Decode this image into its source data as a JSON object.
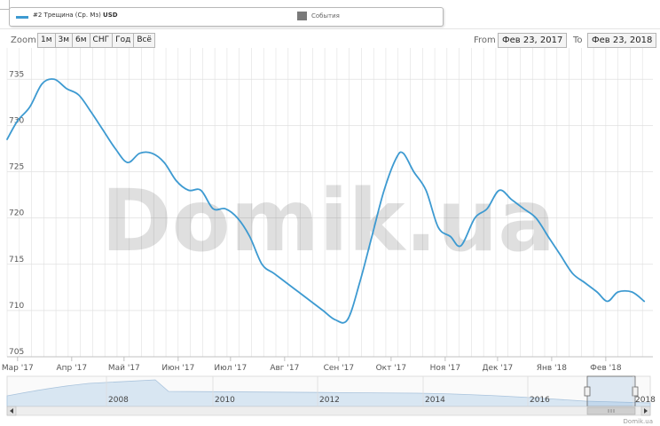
{
  "legend": {
    "series_label": "#2 Трещина (Ср. Мз)",
    "unit_label": "USD",
    "events_label": "События"
  },
  "toolbar": {
    "zoom_label": "Zoom",
    "buttons": [
      "1м",
      "3м",
      "6м",
      "СНГ",
      "Год",
      "Всё"
    ],
    "from_label": "From",
    "from_value": "Фев 23, 2017",
    "to_label": "To",
    "to_value": "Фев 23, 2018"
  },
  "watermark": "Domik.ua",
  "credit": "Domik.ua",
  "colors": {
    "line": "#3d9ad1",
    "navigator_fill": "#d8e6f2",
    "grid": "#e0e0e0"
  },
  "chart_data": {
    "type": "line",
    "ylim": [
      705,
      738
    ],
    "y_ticks": [
      705,
      710,
      715,
      720,
      725,
      730,
      735
    ],
    "x_range": [
      "2017-02-23",
      "2018-02-28"
    ],
    "x_tick_labels": [
      "Мар '17",
      "Апр '17",
      "Май '17",
      "Июн '17",
      "Июл '17",
      "Авг '17",
      "Сен '17",
      "Окт '17",
      "Ноя '17",
      "Дек '17",
      "Янв '18",
      "Фев '18"
    ],
    "x_tick_dates": [
      "2017-03-01",
      "2017-04-01",
      "2017-05-01",
      "2017-06-01",
      "2017-07-01",
      "2017-08-01",
      "2017-09-01",
      "2017-10-01",
      "2017-11-01",
      "2017-12-01",
      "2018-01-01",
      "2018-02-01"
    ],
    "series": [
      {
        "name": "#2 Трещина (Ср. Мз)",
        "points": [
          [
            "2017-02-23",
            728.5
          ],
          [
            "2017-03-01",
            730.5
          ],
          [
            "2017-03-08",
            732
          ],
          [
            "2017-03-15",
            734.5
          ],
          [
            "2017-03-22",
            735
          ],
          [
            "2017-03-29",
            734
          ],
          [
            "2017-04-05",
            733.3
          ],
          [
            "2017-04-12",
            731.5
          ],
          [
            "2017-04-19",
            729.5
          ],
          [
            "2017-04-26",
            727.5
          ],
          [
            "2017-05-03",
            726
          ],
          [
            "2017-05-10",
            727
          ],
          [
            "2017-05-17",
            727
          ],
          [
            "2017-05-24",
            726
          ],
          [
            "2017-05-31",
            724
          ],
          [
            "2017-06-07",
            723
          ],
          [
            "2017-06-14",
            723
          ],
          [
            "2017-06-21",
            721
          ],
          [
            "2017-06-28",
            721
          ],
          [
            "2017-07-05",
            720
          ],
          [
            "2017-07-12",
            718
          ],
          [
            "2017-07-19",
            715
          ],
          [
            "2017-07-26",
            714
          ],
          [
            "2017-08-02",
            713
          ],
          [
            "2017-08-09",
            712
          ],
          [
            "2017-08-16",
            711
          ],
          [
            "2017-08-23",
            710
          ],
          [
            "2017-08-30",
            709
          ],
          [
            "2017-09-06",
            709
          ],
          [
            "2017-09-13",
            713
          ],
          [
            "2017-09-20",
            718
          ],
          [
            "2017-09-27",
            723
          ],
          [
            "2017-10-04",
            726.5
          ],
          [
            "2017-10-08",
            727
          ],
          [
            "2017-10-14",
            725
          ],
          [
            "2017-10-21",
            723
          ],
          [
            "2017-10-28",
            719
          ],
          [
            "2017-11-04",
            718
          ],
          [
            "2017-11-10",
            717
          ],
          [
            "2017-11-18",
            720
          ],
          [
            "2017-11-25",
            721
          ],
          [
            "2017-12-02",
            723
          ],
          [
            "2017-12-09",
            722
          ],
          [
            "2017-12-16",
            721
          ],
          [
            "2017-12-23",
            720
          ],
          [
            "2017-12-30",
            718
          ],
          [
            "2018-01-06",
            716
          ],
          [
            "2018-01-13",
            714
          ],
          [
            "2018-01-20",
            713
          ],
          [
            "2018-01-27",
            712
          ],
          [
            "2018-02-02",
            711
          ],
          [
            "2018-02-08",
            712
          ],
          [
            "2018-02-16",
            712
          ],
          [
            "2018-02-23",
            711
          ]
        ]
      }
    ],
    "navigator": {
      "x_tick_labels": [
        "2008",
        "2010",
        "2012",
        "2014",
        "2016",
        "2018"
      ]
    },
    "grid": true,
    "legend_position": "top"
  }
}
